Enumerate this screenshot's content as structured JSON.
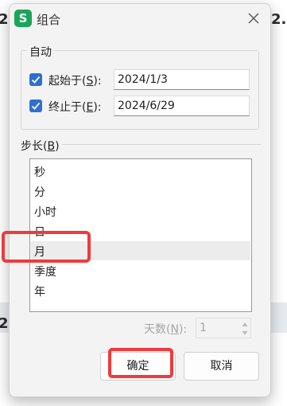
{
  "background": {
    "frag_left": "2",
    "frag_right": "2."
  },
  "dialog": {
    "icon_letter": "S",
    "title": "组合",
    "auto_group": {
      "label": "自动",
      "start": {
        "checked": true,
        "label_text": "起始于(",
        "label_key": "S",
        "label_end": "):",
        "value": "2024/1/3"
      },
      "end": {
        "checked": true,
        "label_text": "终止于(",
        "label_key": "E",
        "label_end": "):",
        "value": "2024/6/29"
      }
    },
    "step": {
      "label_text": "步长(",
      "label_key": "B",
      "label_end": ")",
      "items": [
        "秒",
        "分",
        "小时",
        "日",
        "月",
        "季度",
        "年"
      ],
      "selected": "月"
    },
    "days": {
      "label_text": "天数(",
      "label_key": "N",
      "label_end": "):",
      "value": "1"
    },
    "buttons": {
      "ok": "确定",
      "cancel": "取消"
    }
  },
  "colors": {
    "accent": "#2f6fd3",
    "highlight": "#ee3b3b",
    "app_icon": "#1aa55a"
  }
}
